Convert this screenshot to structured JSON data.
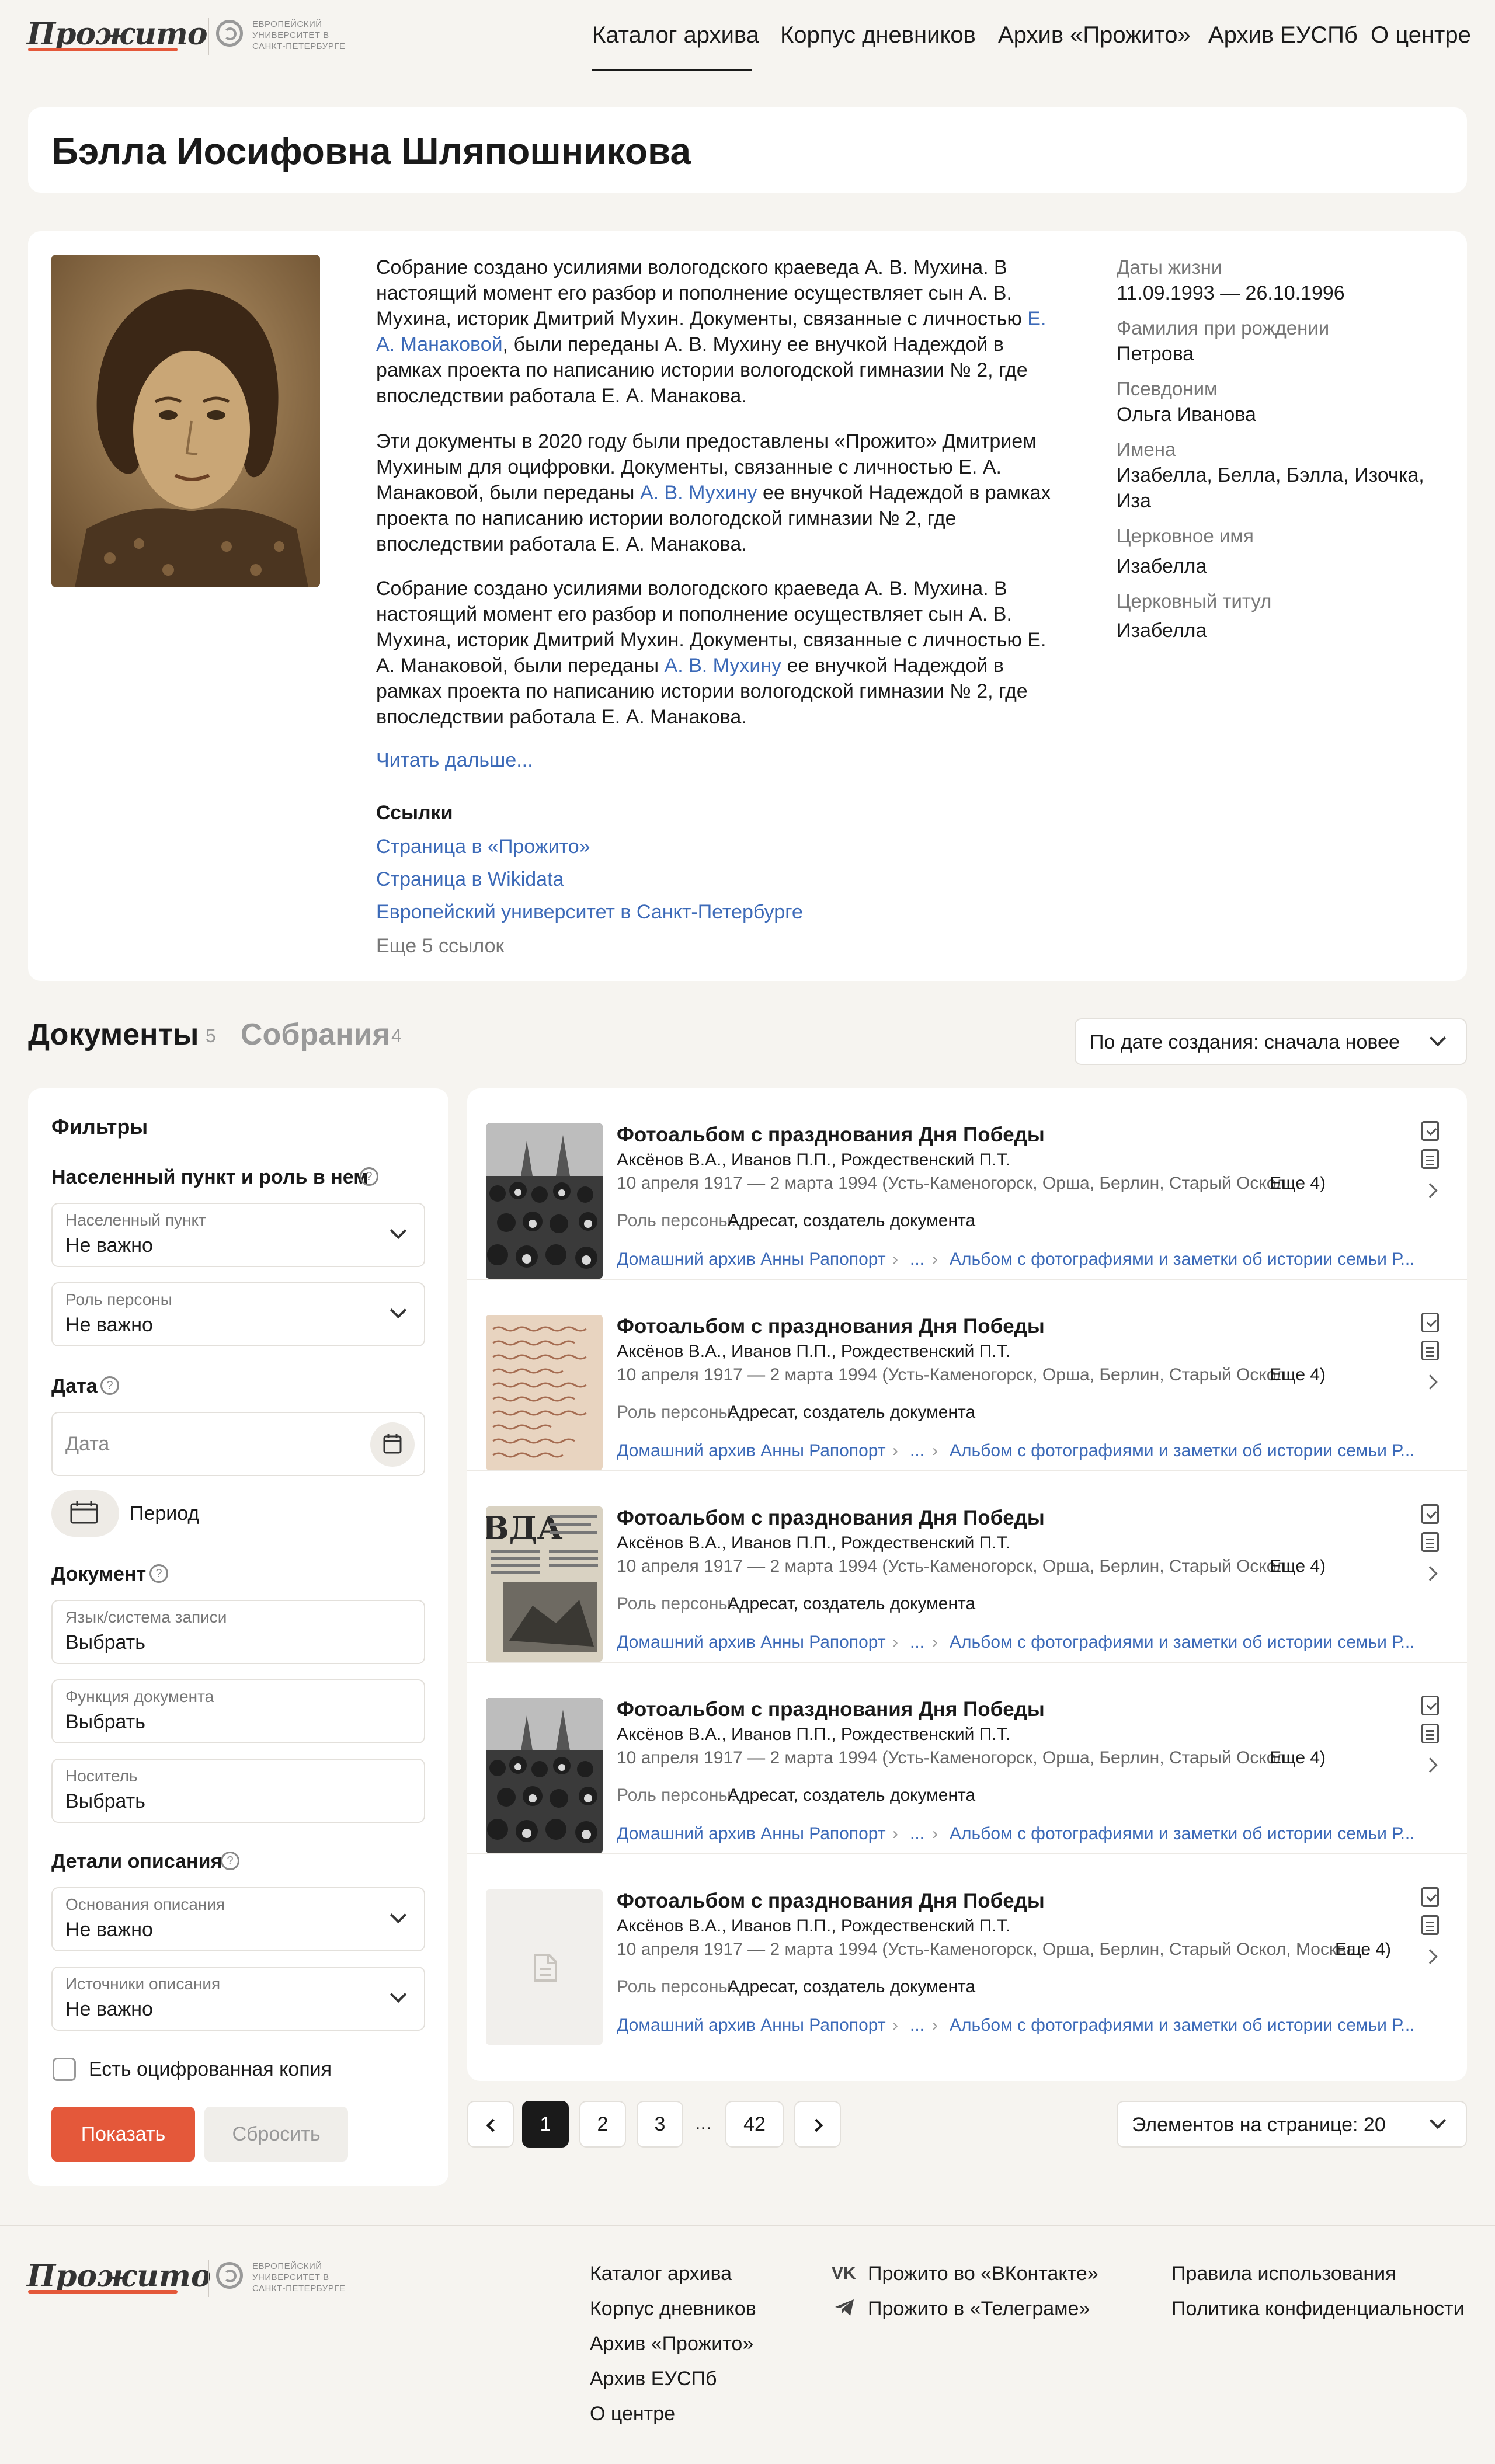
{
  "header": {
    "logo_text": "Прожито",
    "partner_text": "Европейский университет в Санкт-Петербурге",
    "nav": [
      "Каталог архива",
      "Корпус дневников",
      "Архив «Прожито»",
      "Архив ЕУСПб",
      "О центре"
    ]
  },
  "person": {
    "name": "Бэлла Иосифовна Шляпошникова",
    "bio": {
      "p1a": "Собрание создано усилиями вологодского краеведа А. В. Мухина. В настоящий момент его разбор и пополнение осуществляет сын А. В. Мухина, историк Дмитрий Мухин. Документы, связанные с личностью",
      "p1_link": "Е. А. Манаковой",
      "p1b": ", были переданы А. В. Мухину ее внучкой Надеждой в рамках проекта по написанию истории вологодской гимназии № 2, где впоследствии работала Е. А. Манакова.",
      "p2a": "Эти документы в 2020 году были предоставлены «Прожито» Дмитрием Мухиным для оцифровки. Документы, связанные с личностью Е. А. Манаковой, были переданы",
      "p2_link": "А. В. Мухину",
      "p2b": "ее внучкой Надеждой в рамках проекта по написанию истории вологодской гимназии № 2, где впоследствии работала Е. А. Манакова.",
      "p3a": "Собрание создано усилиями вологодского краеведа А. В. Мухина. В настоящий момент его разбор и пополнение осуществляет сын А. В. Мухина, историк Дмитрий Мухин. Документы, связанные с личностью Е. А. Манаковой, были переданы",
      "p3_link": "А. В. Мухину",
      "p3b": "ее внучкой Надеждой в рамках проекта по написанию истории вологодской гимназии № 2, где впоследствии работала Е. А. Манакова.",
      "read_more": "Читать дальше..."
    },
    "links": {
      "title": "Ссылки",
      "items": [
        "Страница в «Прожито»",
        "Страница в Wikidata",
        "Европейский университет в Санкт-Петербурге"
      ],
      "more": "Еще 5 ссылок"
    },
    "meta": [
      {
        "label": "Даты жизни",
        "value": "11.09.1993 — 26.10.1996"
      },
      {
        "label": "Фамилия при рождении",
        "value": "Петрова"
      },
      {
        "label": "Псевдоним",
        "value": "Ольга Иванова"
      },
      {
        "label": "Имена",
        "value": "Изабелла, Белла, Бэлла, Изочка, Иза"
      },
      {
        "label": "Церковное имя",
        "value": "Изабелла"
      },
      {
        "label": "Церковный титул",
        "value": "Изабелла"
      }
    ]
  },
  "tabs": [
    {
      "label": "Документы",
      "count": "5"
    },
    {
      "label": "Собрания",
      "count": "4"
    }
  ],
  "sort": {
    "value": "По дате создания: сначала новее"
  },
  "filters": {
    "title": "Фильтры",
    "sections": {
      "place": "Населенный пункт и роль в нем",
      "date": "Дата",
      "document": "Документ",
      "details": "Детали описания"
    },
    "settlement": {
      "label": "Населенный пункт",
      "value": "Не важно"
    },
    "role": {
      "label": "Роль персоны",
      "value": "Не важно"
    },
    "date_placeholder": "Дата",
    "period": "Период",
    "language": {
      "label": "Язык/система записи",
      "value": "Выбрать"
    },
    "function": {
      "label": "Функция документа",
      "value": "Выбрать"
    },
    "carrier": {
      "label": "Носитель",
      "value": "Выбрать"
    },
    "basis": {
      "label": "Основания описания",
      "value": "Не важно"
    },
    "sources": {
      "label": "Источники описания",
      "value": "Не важно"
    },
    "digital_copy": "Есть оцифрованная копия",
    "show": "Показать",
    "reset": "Сбросить"
  },
  "results": [
    {
      "title": "Фотоальбом с празднования Дня Победы",
      "authors": "Аксёнов В.А., Иванов П.П., Рождественский П.Т.",
      "dates": "10 апреля 1917 — 2 марта 1994 (Усть-Каменогорск, Орша, Берлин, Старый Оскол...",
      "more": "Еще 4)",
      "role_label": "Роль персоны:",
      "role": "Адресат, создатель документа",
      "crumb1": "Домашний архив Анны Рапопорт",
      "ellipsis": "...",
      "crumb2": "Альбом с фотографиями и заметки об истории семьи Р..."
    },
    {
      "title": "Фотоальбом с празднования Дня Победы",
      "authors": "Аксёнов В.А., Иванов П.П., Рождественский П.Т.",
      "dates": "10 апреля 1917 — 2 марта 1994 (Усть-Каменогорск, Орша, Берлин, Старый Оскол...",
      "more": "Еще 4)",
      "role_label": "Роль персоны:",
      "role": "Адресат, создатель документа",
      "crumb1": "Домашний архив Анны Рапопорт",
      "ellipsis": "...",
      "crumb2": "Альбом с фотографиями и заметки об истории семьи Р..."
    },
    {
      "title": "Фотоальбом с празднования Дня Победы",
      "authors": "Аксёнов В.А., Иванов П.П., Рождественский П.Т.",
      "dates": "10 апреля 1917 — 2 марта 1994 (Усть-Каменогорск, Орша, Берлин, Старый Оскол...",
      "more": "Еще 4)",
      "role_label": "Роль персоны:",
      "role": "Адресат, создатель документа",
      "crumb1": "Домашний архив Анны Рапопорт",
      "ellipsis": "...",
      "crumb2": "Альбом с фотографиями и заметки об истории семьи Р...",
      "thumb_text": "ВДА"
    },
    {
      "title": "Фотоальбом с празднования Дня Победы",
      "authors": "Аксёнов В.А., Иванов П.П., Рождественский П.Т.",
      "dates": "10 апреля 1917 — 2 марта 1994 (Усть-Каменогорск, Орша, Берлин, Старый Оскол...",
      "more": "Еще 4)",
      "role_label": "Роль персоны:",
      "role": "Адресат, создатель документа",
      "crumb1": "Домашний архив Анны Рапопорт",
      "ellipsis": "...",
      "crumb2": "Альбом с фотографиями и заметки об истории семьи Р..."
    },
    {
      "title": "Фотоальбом с празднования Дня Победы",
      "authors": "Аксёнов В.А., Иванов П.П., Рождественский П.Т.",
      "dates": "10 апреля 1917 — 2 марта 1994 (Усть-Каменогорск, Орша, Берлин, Старый Оскол, Москва...",
      "more": "Еще 4)",
      "role_label": "Роль персоны:",
      "role": "Адресат, создатель документа",
      "crumb1": "Домашний архив Анны Рапопорт",
      "ellipsis": "...",
      "crumb2": "Альбом с фотографиями и заметки об истории семьи Р..."
    }
  ],
  "pagination": {
    "pages": [
      "1",
      "2",
      "3"
    ],
    "ellipsis": "...",
    "last": "42",
    "per_page": "Элементов на странице: 20"
  },
  "footer": {
    "logo_text": "Прожито",
    "partner_text": "Европейский университет в Санкт-Петербурге",
    "nav": [
      "Каталог архива",
      "Корпус дневников",
      "Архив «Прожито»",
      "Архив ЕУСПб",
      "О центре"
    ],
    "social": [
      "Прожито во «ВКонтакте»",
      "Прожито в «Телеграме»"
    ],
    "legal": [
      "Правила использования",
      "Политика конфиденциальности"
    ]
  },
  "colors": {
    "accent": "#e4583a",
    "link": "#3c6ab8",
    "background": "#f6f4f0"
  }
}
